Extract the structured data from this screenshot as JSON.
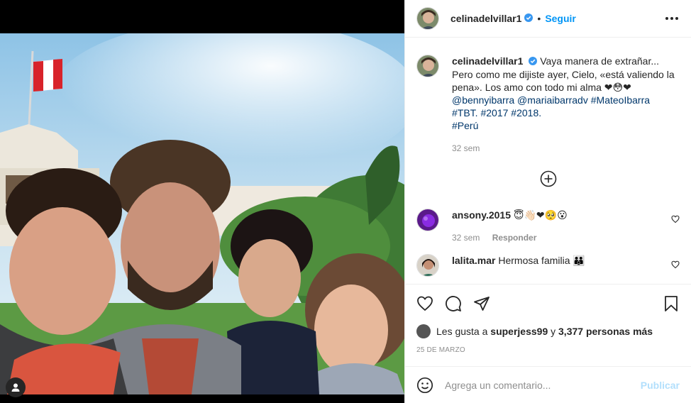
{
  "header": {
    "username": "celinadelvillar1",
    "follow_label": "Seguir"
  },
  "caption": {
    "username": "celinadelvillar1",
    "line1": "Vaya manera de extrañar... Pero como me dijiste ayer, Cielo, «está valiendo la pena». Los amo con todo mi alma ❤😳❤",
    "mentions": [
      "@bennyibarra",
      "@mariaibarradv",
      "#MateoIbarra"
    ],
    "hashtags": [
      "#TBT.",
      "#2017",
      "#2018."
    ],
    "last_tag": "#Perú",
    "time": "32 sem"
  },
  "comments": [
    {
      "username": "ansony.2015",
      "text": "😇👋🏻❤🥺😮",
      "time": "32 sem",
      "reply_label": "Responder"
    },
    {
      "username": "lalita.mar",
      "text": "Hermosa familia 👪"
    }
  ],
  "likes": {
    "prefix": "Les gusta a",
    "user": "superjess99",
    "joiner": "y",
    "others": "3,377 personas más"
  },
  "date": "25 DE MARZO",
  "add_comment": {
    "placeholder": "Agrega un comentario...",
    "publish_label": "Publicar"
  },
  "colors": {
    "accent": "#0095f6",
    "link": "#00376b",
    "muted": "#8e8e8e",
    "publish_disabled": "#b2dffc"
  }
}
